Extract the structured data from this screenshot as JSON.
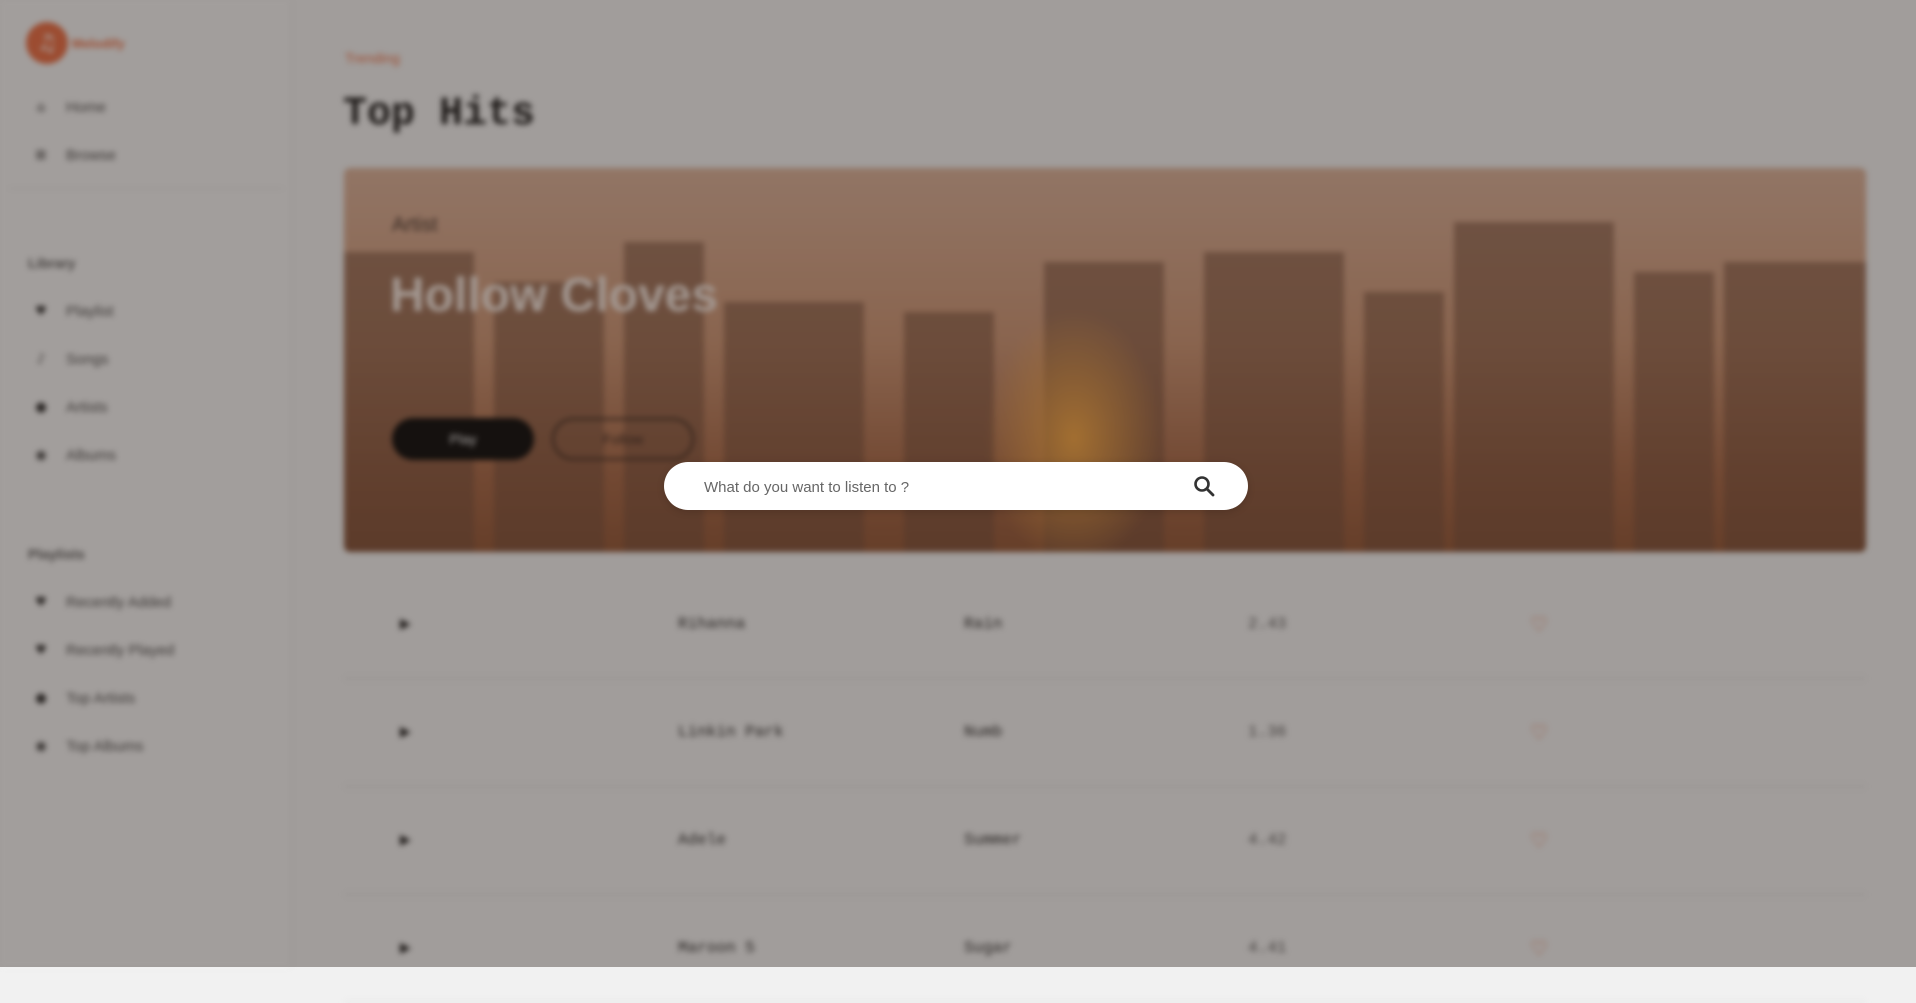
{
  "brand": {
    "name": "Melodify",
    "logo_glyph": "♫"
  },
  "sidebar": {
    "main_nav": [
      {
        "label": "Home",
        "icon": "home-icon",
        "glyph": "⌂"
      },
      {
        "label": "Browse",
        "icon": "browse-icon",
        "glyph": "⊞"
      }
    ],
    "library_title": "Library",
    "library": [
      {
        "label": "Playlist",
        "icon": "playlist-icon",
        "glyph": "♥"
      },
      {
        "label": "Songs",
        "icon": "music-note-icon",
        "glyph": "♪"
      },
      {
        "label": "Artists",
        "icon": "artist-icon",
        "glyph": "●"
      },
      {
        "label": "Albums",
        "icon": "album-icon",
        "glyph": "◉"
      }
    ],
    "playlists_title": "Playlists",
    "playlists": [
      {
        "label": "Recently Added",
        "icon": "heart-icon",
        "glyph": "♥"
      },
      {
        "label": "Recently Played",
        "icon": "heart-icon",
        "glyph": "♥"
      },
      {
        "label": "Top Artists",
        "icon": "artist-icon",
        "glyph": "●"
      },
      {
        "label": "Top Albums",
        "icon": "album-icon",
        "glyph": "◉"
      }
    ]
  },
  "main": {
    "eyebrow": "Trending",
    "title": "Top Hits",
    "hero": {
      "kicker": "Artist",
      "name": "Hollow Cloves",
      "play_label": "Play",
      "follow_label": "Follow"
    },
    "tracks": [
      {
        "artist": "Rihanna",
        "song": "Rain",
        "duration": "2.43"
      },
      {
        "artist": "Linkin Park",
        "song": "Numb",
        "duration": "1.36"
      },
      {
        "artist": "Adele",
        "song": "Summer",
        "duration": "4.42"
      },
      {
        "artist": "Maroon 5",
        "song": "Sugar",
        "duration": "4.41"
      }
    ],
    "play_glyph": "▶",
    "heart_glyph": "♡"
  },
  "search": {
    "placeholder": "What do you want to listen to ?"
  },
  "colors": {
    "accent": "#e8673c",
    "overlay": "rgba(50,40,35,0.42)"
  }
}
